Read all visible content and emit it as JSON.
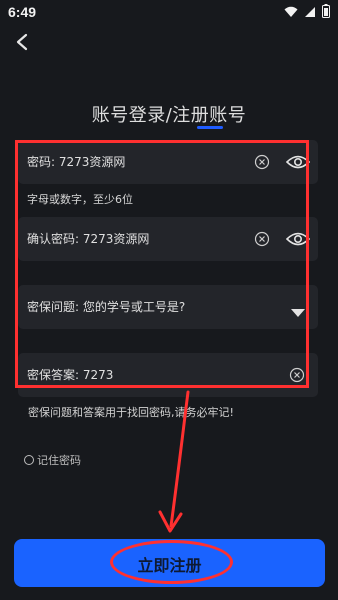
{
  "status_bar": {
    "time": "6:49"
  },
  "header": {
    "title": "账号登录/注册账号"
  },
  "form": {
    "password_label": "密码: 7273资源网",
    "password_hint": "字母或数字，至少6位",
    "confirm_label": "确认密码: 7273资源网",
    "security_question_label": "密保问题: 您的学号或工号是?",
    "security_answer_label": "密保答案: 7273",
    "note": "密保问题和答案用于找回密码,请务必牢记!",
    "remember_label": "记住密码"
  },
  "actions": {
    "register_label": "立即注册"
  },
  "colors": {
    "background": "#17191d",
    "field_bg": "#23252a",
    "accent": "#1a63ff",
    "annotation": "#ff3030"
  },
  "icons": {
    "back": "back-arrow-icon",
    "clear": "clear-circle-icon",
    "eye": "eye-icon",
    "dropdown": "dropdown-triangle-icon",
    "wifi": "wifi-icon",
    "signal": "signal-icon",
    "battery": "battery-icon"
  }
}
